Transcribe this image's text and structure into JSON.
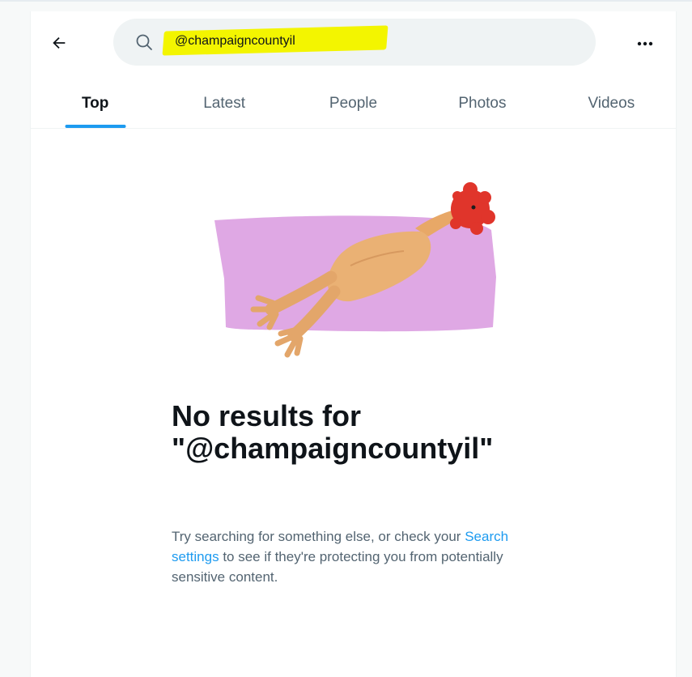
{
  "search": {
    "query": "@champaigncountyil",
    "highlight_color": "#f3f500"
  },
  "tabs": [
    {
      "label": "Top",
      "active": true
    },
    {
      "label": "Latest",
      "active": false
    },
    {
      "label": "People",
      "active": false
    },
    {
      "label": "Photos",
      "active": false
    },
    {
      "label": "Videos",
      "active": false
    }
  ],
  "empty_state": {
    "title_prefix": "No results for",
    "title_query": "\"@champaigncountyil\"",
    "text_before_link": "Try searching for something else, or check your ",
    "link_text": "Search settings",
    "text_after_link": " to see if they're protecting you from potentially sensitive content."
  },
  "icons": {
    "back": "arrow-left-icon",
    "search": "search-icon",
    "more": "more-horizontal-icon"
  },
  "colors": {
    "accent": "#1d9bf0",
    "text_primary": "#0f1419",
    "text_secondary": "#536471",
    "illustration_bg": "#dfa8e4"
  }
}
